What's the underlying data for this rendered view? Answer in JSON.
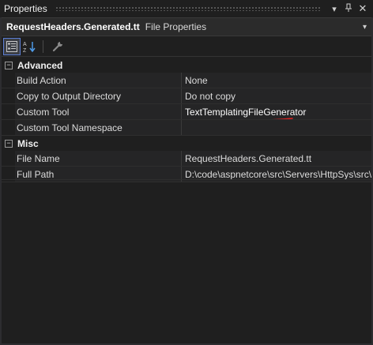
{
  "window": {
    "title": "Properties",
    "buttons": {
      "dropdown": "▾",
      "pin": "ᛀ",
      "close": "✕"
    }
  },
  "selector": {
    "object_name": "RequestHeaders.Generated.tt",
    "object_type": "File Properties",
    "dropdown": "▾"
  },
  "toolbar": {
    "buttons": [
      "categorized-icon",
      "alphabetical-icon",
      "property-pages-icon"
    ]
  },
  "categories": [
    {
      "label": "Advanced",
      "toggle": "−",
      "rows": [
        {
          "name": "Build Action",
          "value": "None"
        },
        {
          "name": "Copy to Output Directory",
          "value": "Do not copy"
        },
        {
          "name": "Custom Tool",
          "value": "TextTemplatingFileGenerator"
        },
        {
          "name": "Custom Tool Namespace",
          "value": ""
        }
      ]
    },
    {
      "label": "Misc",
      "toggle": "−",
      "rows": [
        {
          "name": "File Name",
          "value": "RequestHeaders.Generated.tt"
        },
        {
          "name": "Full Path",
          "value": "D:\\code\\aspnetcore\\src\\Servers\\HttpSys\\src\\"
        }
      ]
    }
  ],
  "colors": {
    "background": "#1f1f1f",
    "accent": "#5c7fd6",
    "annotation": "#e02020"
  }
}
